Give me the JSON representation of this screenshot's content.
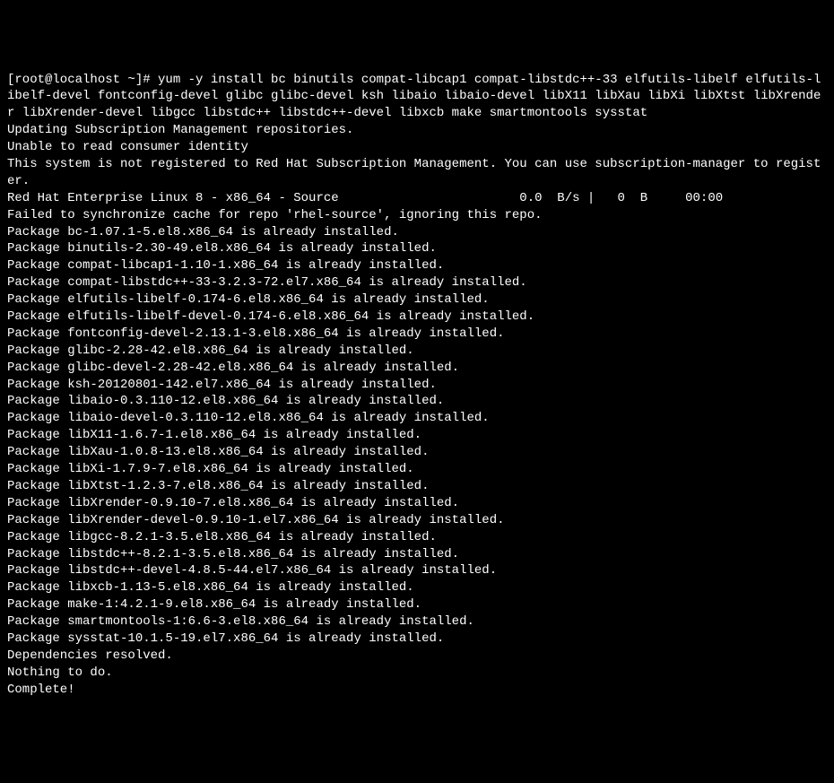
{
  "prompt": "[root@localhost ~]# ",
  "command": "yum -y install bc binutils compat-libcap1 compat-libstdc++-33 elfutils-libelf elfutils-libelf-devel fontconfig-devel glibc glibc-devel ksh libaio libaio-devel libX11 libXau libXi libXtst libXrender libXrender-devel libgcc libstdc++ libstdc++-devel libxcb make smartmontools sysstat",
  "lines": [
    "Updating Subscription Management repositories.",
    "Unable to read consumer identity",
    "This system is not registered to Red Hat Subscription Management. You can use subscription-manager to register.",
    "Red Hat Enterprise Linux 8 - x86_64 - Source                        0.0  B/s |   0  B     00:00",
    "Failed to synchronize cache for repo 'rhel-source', ignoring this repo.",
    "Package bc-1.07.1-5.el8.x86_64 is already installed.",
    "Package binutils-2.30-49.el8.x86_64 is already installed.",
    "Package compat-libcap1-1.10-1.x86_64 is already installed.",
    "Package compat-libstdc++-33-3.2.3-72.el7.x86_64 is already installed.",
    "Package elfutils-libelf-0.174-6.el8.x86_64 is already installed.",
    "Package elfutils-libelf-devel-0.174-6.el8.x86_64 is already installed.",
    "Package fontconfig-devel-2.13.1-3.el8.x86_64 is already installed.",
    "Package glibc-2.28-42.el8.x86_64 is already installed.",
    "Package glibc-devel-2.28-42.el8.x86_64 is already installed.",
    "Package ksh-20120801-142.el7.x86_64 is already installed.",
    "Package libaio-0.3.110-12.el8.x86_64 is already installed.",
    "Package libaio-devel-0.3.110-12.el8.x86_64 is already installed.",
    "Package libX11-1.6.7-1.el8.x86_64 is already installed.",
    "Package libXau-1.0.8-13.el8.x86_64 is already installed.",
    "Package libXi-1.7.9-7.el8.x86_64 is already installed.",
    "Package libXtst-1.2.3-7.el8.x86_64 is already installed.",
    "Package libXrender-0.9.10-7.el8.x86_64 is already installed.",
    "Package libXrender-devel-0.9.10-1.el7.x86_64 is already installed.",
    "Package libgcc-8.2.1-3.5.el8.x86_64 is already installed.",
    "Package libstdc++-8.2.1-3.5.el8.x86_64 is already installed.",
    "Package libstdc++-devel-4.8.5-44.el7.x86_64 is already installed.",
    "Package libxcb-1.13-5.el8.x86_64 is already installed.",
    "Package make-1:4.2.1-9.el8.x86_64 is already installed.",
    "Package smartmontools-1:6.6-3.el8.x86_64 is already installed.",
    "Package sysstat-10.1.5-19.el7.x86_64 is already installed.",
    "Dependencies resolved.",
    "Nothing to do.",
    "Complete!"
  ]
}
